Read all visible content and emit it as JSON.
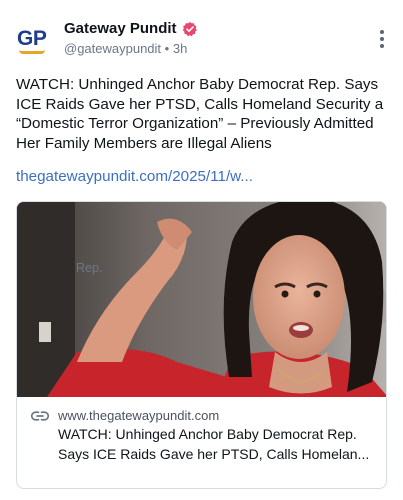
{
  "author": {
    "avatar_text": "GP",
    "display_name": "Gateway Pundit",
    "handle": "@gatewaypundit",
    "separator": "•",
    "time": "3h",
    "verified": true
  },
  "post": {
    "text": "WATCH: Unhinged Anchor Baby Democrat Rep. Says ICE Raids Gave her PTSD, Calls Homeland Security a “Domestic Terror Organization” – Previously Admitted Her Family Members are Illegal Aliens",
    "link_text": "thegatewaypundit.com/2025/11/w..."
  },
  "link_card": {
    "domain": "www.thegatewaypundit.com",
    "title": "WATCH: Unhinged Anchor Baby Democrat Rep. Says ICE Raids Gave her PTSD, Calls Homelan...",
    "description": "Rep."
  },
  "colors": {
    "link": "#3b6fc4",
    "badge": "#e8476e",
    "brand_blue": "#1f3c8a",
    "brand_gold": "#e8a427"
  },
  "icons": {
    "badge": "verified-badge-icon",
    "more": "more-vertical-icon",
    "link": "link-icon"
  }
}
